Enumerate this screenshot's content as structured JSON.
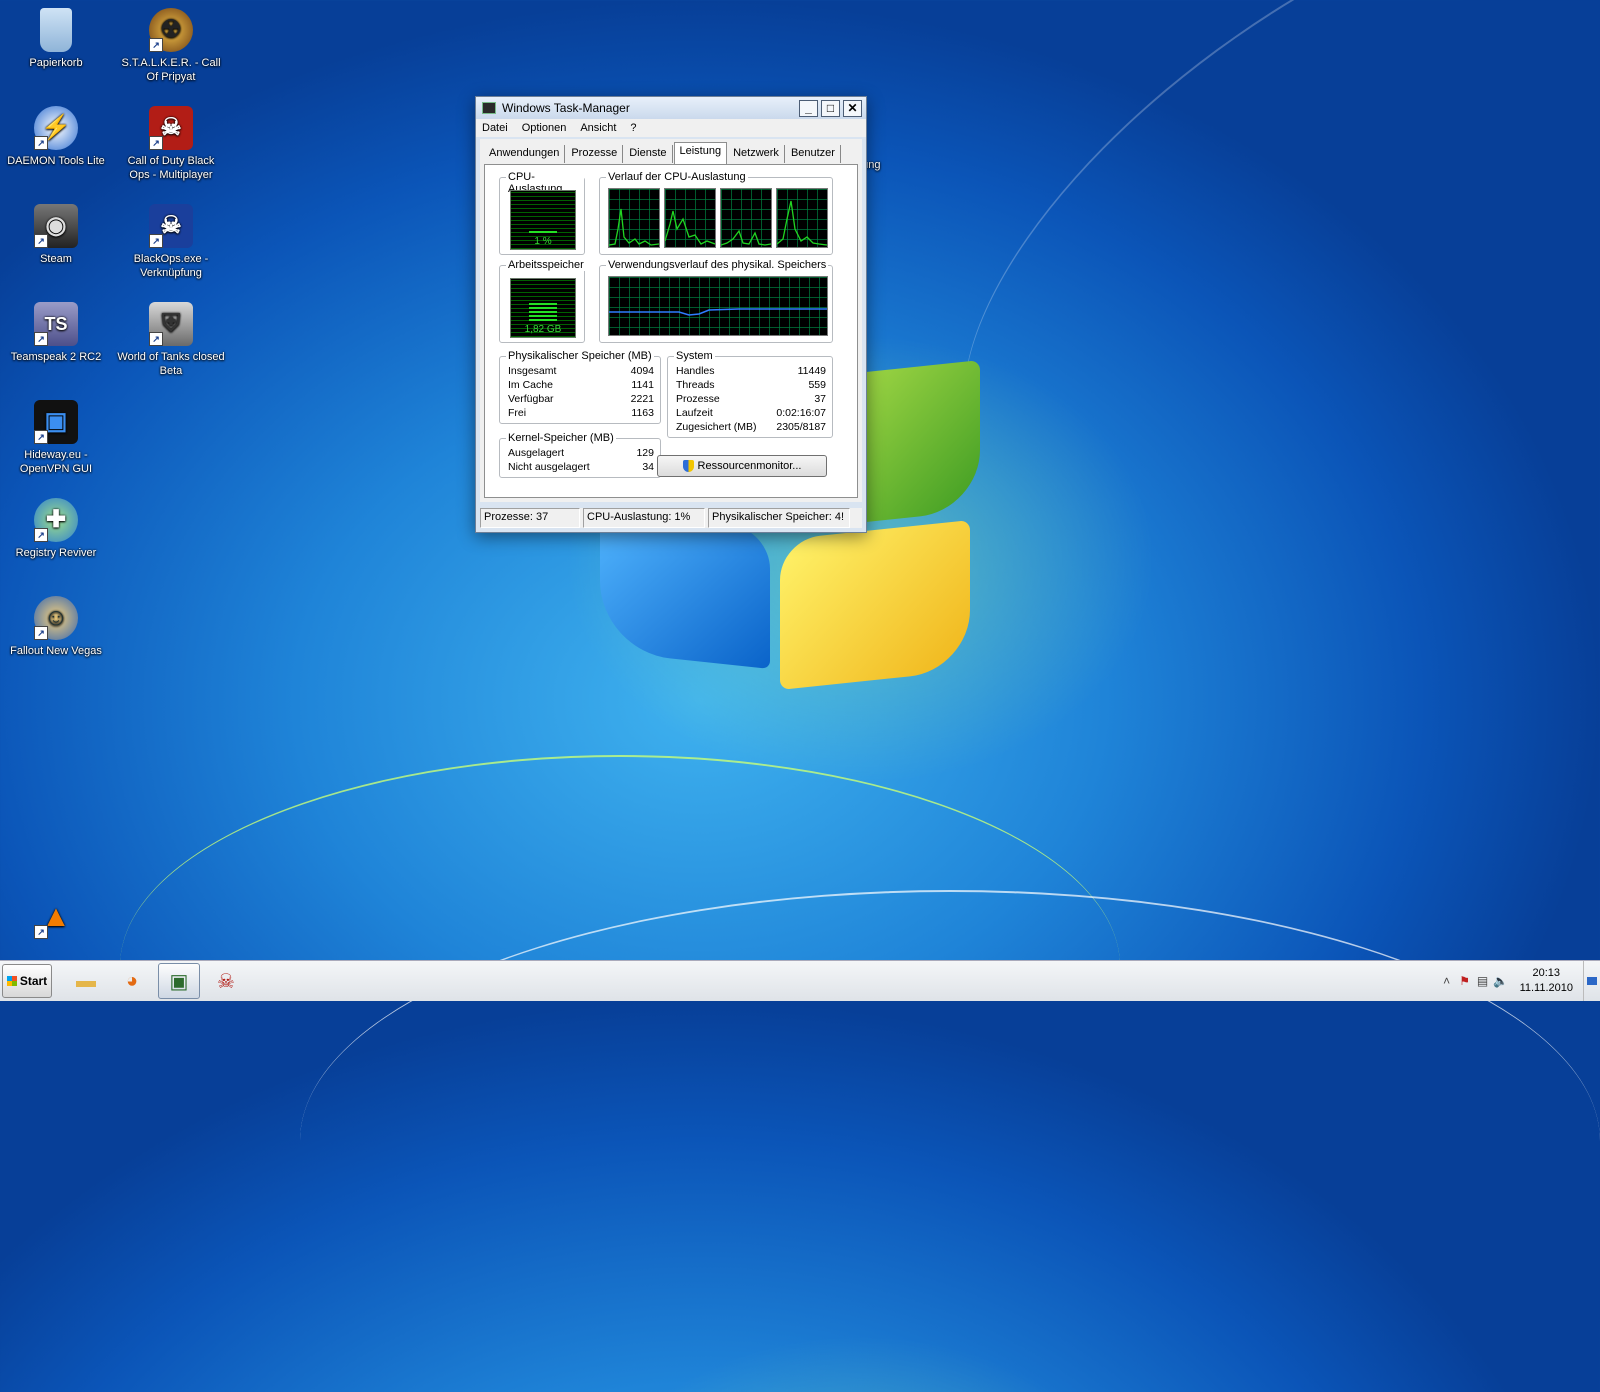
{
  "desktop": {
    "icons": [
      {
        "label": "Papierkorb",
        "icon": "recycle-bin-icon"
      },
      {
        "label": "S.T.A.L.K.E.R. - Call Of Pripyat",
        "icon": "stalker-icon"
      },
      {
        "label": "DAEMON Tools Lite",
        "icon": "daemon-tools-icon"
      },
      {
        "label": "Call of Duty Black Ops - Multiplayer",
        "icon": "cod-skull-icon"
      },
      {
        "label": "Steam",
        "icon": "steam-icon"
      },
      {
        "label": "BlackOps.exe - Verknüpfung",
        "icon": "cod-skull-icon"
      },
      {
        "label": "Teamspeak 2 RC2",
        "icon": "teamspeak-icon"
      },
      {
        "label": "World of Tanks closed Beta",
        "icon": "wot-icon"
      },
      {
        "label": "Hideway.eu - OpenVPN GUI",
        "icon": "openvpn-icon"
      },
      {
        "label": "Registry Reviver",
        "icon": "registry-reviver-icon"
      },
      {
        "label": "Fallout New Vegas",
        "icon": "fallout-icon"
      },
      {
        "label": "",
        "icon": "vlc-icon"
      },
      {
        "label": "exe - fung",
        "icon": "shortcut-icon"
      }
    ]
  },
  "taskmgr": {
    "title": "Windows Task-Manager",
    "menu": [
      "Datei",
      "Optionen",
      "Ansicht",
      "?"
    ],
    "tabs": [
      "Anwendungen",
      "Prozesse",
      "Dienste",
      "Leistung",
      "Netzwerk",
      "Benutzer"
    ],
    "active_tab": "Leistung",
    "cpu": {
      "label": "CPU-Auslastung",
      "value": "1 %",
      "level": 0.01
    },
    "cpu_history": {
      "label": "Verlauf der CPU-Auslastung"
    },
    "memory": {
      "label": "Arbeitsspeicher",
      "value": "1,82 GB",
      "level": 0.44
    },
    "memory_history": {
      "label": "Verwendungsverlauf des physikal. Speichers"
    },
    "physical": {
      "label": "Physikalischer Speicher (MB)",
      "rows": [
        {
          "k": "Insgesamt",
          "v": "4094"
        },
        {
          "k": "Im Cache",
          "v": "1141"
        },
        {
          "k": "Verfügbar",
          "v": "2221"
        },
        {
          "k": "Frei",
          "v": "1163"
        }
      ]
    },
    "kernel": {
      "label": "Kernel-Speicher (MB)",
      "rows": [
        {
          "k": "Ausgelagert",
          "v": "129"
        },
        {
          "k": "Nicht ausgelagert",
          "v": "34"
        }
      ]
    },
    "system": {
      "label": "System",
      "rows": [
        {
          "k": "Handles",
          "v": "11449"
        },
        {
          "k": "Threads",
          "v": "559"
        },
        {
          "k": "Prozesse",
          "v": "37"
        },
        {
          "k": "Laufzeit",
          "v": "0:02:16:07"
        },
        {
          "k": "Zugesichert (MB)",
          "v": "2305/8187"
        }
      ]
    },
    "resource_button": "Ressourcenmonitor...",
    "status": {
      "processes": "Prozesse: 37",
      "cpu": "CPU-Auslastung: 1%",
      "memory": "Physikalischer Speicher: 4!"
    }
  },
  "taskbar": {
    "start_label": "Start",
    "clock_time": "20:13",
    "clock_date": "11.11.2010"
  },
  "colors": {
    "graph_line": "#22d422",
    "memory_line": "#2f7cff",
    "desktop_blue": "#1f84d8"
  }
}
